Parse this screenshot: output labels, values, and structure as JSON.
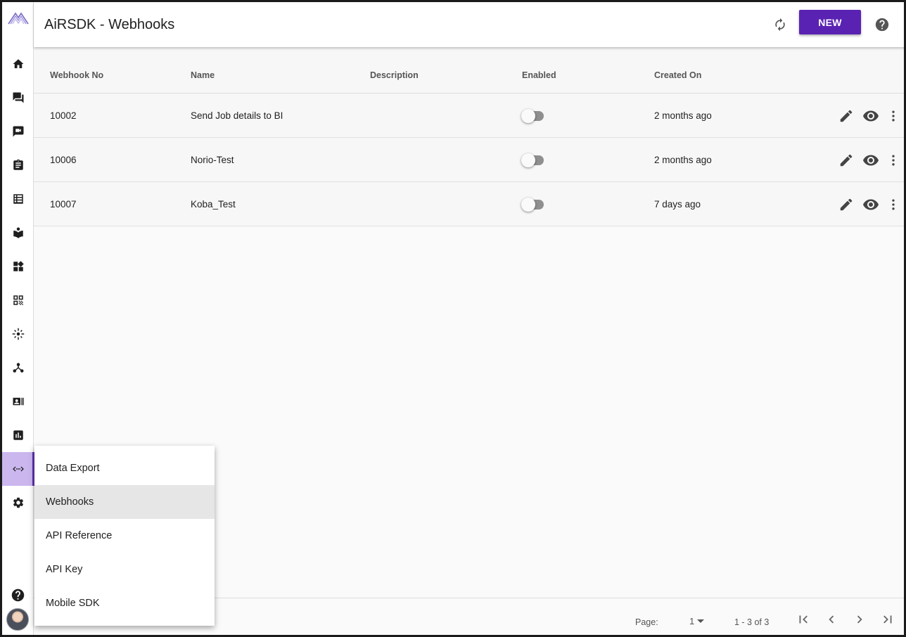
{
  "header": {
    "title": "AiRSDK - Webhooks",
    "new_label": "NEW"
  },
  "sidebar": {
    "items": [
      {
        "icon": "home-icon"
      },
      {
        "icon": "chat-icon"
      },
      {
        "icon": "video-chat-icon"
      },
      {
        "icon": "clipboard-icon"
      },
      {
        "icon": "list-icon"
      },
      {
        "icon": "book-icon"
      },
      {
        "icon": "widgets-icon"
      },
      {
        "icon": "qr-code-icon"
      },
      {
        "icon": "center-focus-icon"
      },
      {
        "icon": "hub-icon"
      },
      {
        "icon": "contact-card-icon"
      },
      {
        "icon": "analytics-icon"
      },
      {
        "icon": "code-icon",
        "active": true
      },
      {
        "icon": "gear-icon"
      }
    ]
  },
  "table": {
    "columns": [
      "Webhook No",
      "Name",
      "Description",
      "Enabled",
      "Created On"
    ],
    "rows": [
      {
        "no": "10002",
        "name": "Send Job details to BI",
        "description": "",
        "enabled": false,
        "created": "2 months ago"
      },
      {
        "no": "10006",
        "name": "Norio-Test",
        "description": "",
        "enabled": false,
        "created": "2 months ago"
      },
      {
        "no": "10007",
        "name": "Koba_Test",
        "description": "",
        "enabled": false,
        "created": "7 days ago"
      }
    ]
  },
  "footer": {
    "page_label": "Page:",
    "page_value": "1",
    "range": "1 - 3 of 3"
  },
  "menu": {
    "items": [
      {
        "label": "Data Export",
        "selected": false
      },
      {
        "label": "Webhooks",
        "selected": true
      },
      {
        "label": "API Reference",
        "selected": false
      },
      {
        "label": "API Key",
        "selected": false
      },
      {
        "label": "Mobile SDK",
        "selected": false
      }
    ]
  },
  "colors": {
    "accent": "#5a22b2",
    "active_nav_bg": "#cbb7ee",
    "active_nav_bar": "#5e35b1"
  }
}
